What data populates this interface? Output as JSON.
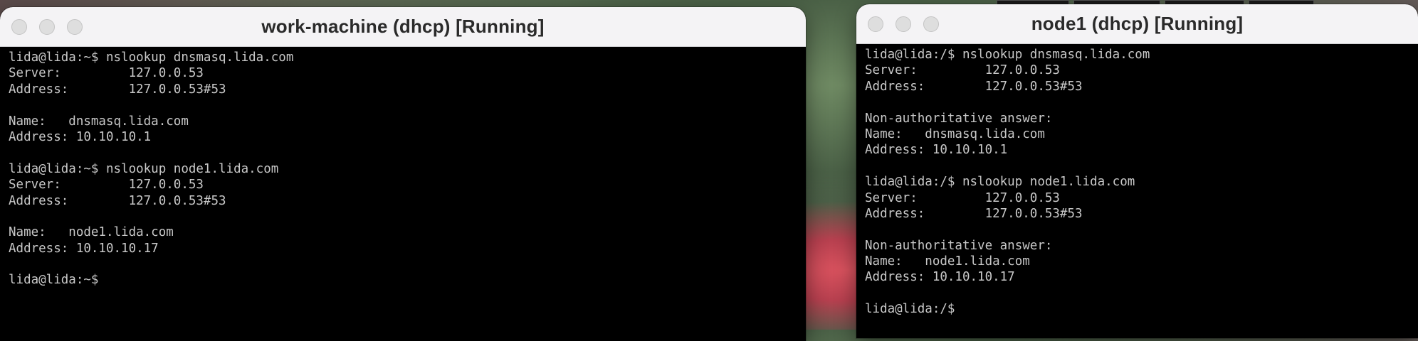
{
  "windows": [
    {
      "id": "work-machine",
      "title": "work-machine (dhcp) [Running]",
      "lines": [
        "lida@lida:~$ nslookup dnsmasq.lida.com",
        "Server:         127.0.0.53",
        "Address:        127.0.0.53#53",
        "",
        "Name:   dnsmasq.lida.com",
        "Address: 10.10.10.1",
        "",
        "lida@lida:~$ nslookup node1.lida.com",
        "Server:         127.0.0.53",
        "Address:        127.0.0.53#53",
        "",
        "Name:   node1.lida.com",
        "Address: 10.10.10.17",
        "",
        "lida@lida:~$"
      ]
    },
    {
      "id": "node1",
      "title": "node1 (dhcp) [Running]",
      "lines": [
        "lida@lida:/$ nslookup dnsmasq.lida.com",
        "Server:         127.0.0.53",
        "Address:        127.0.0.53#53",
        "",
        "Non-authoritative answer:",
        "Name:   dnsmasq.lida.com",
        "Address: 10.10.10.1",
        "",
        "lida@lida:/$ nslookup node1.lida.com",
        "Server:         127.0.0.53",
        "Address:        127.0.0.53#53",
        "",
        "Non-authoritative answer:",
        "Name:   node1.lida.com",
        "Address: 10.10.10.17",
        "",
        "lida@lida:/$"
      ]
    }
  ],
  "colors": {
    "terminal_bg": "#000000",
    "terminal_fg": "#c8c8c8",
    "titlebar_bg": "#f4f3f5"
  }
}
